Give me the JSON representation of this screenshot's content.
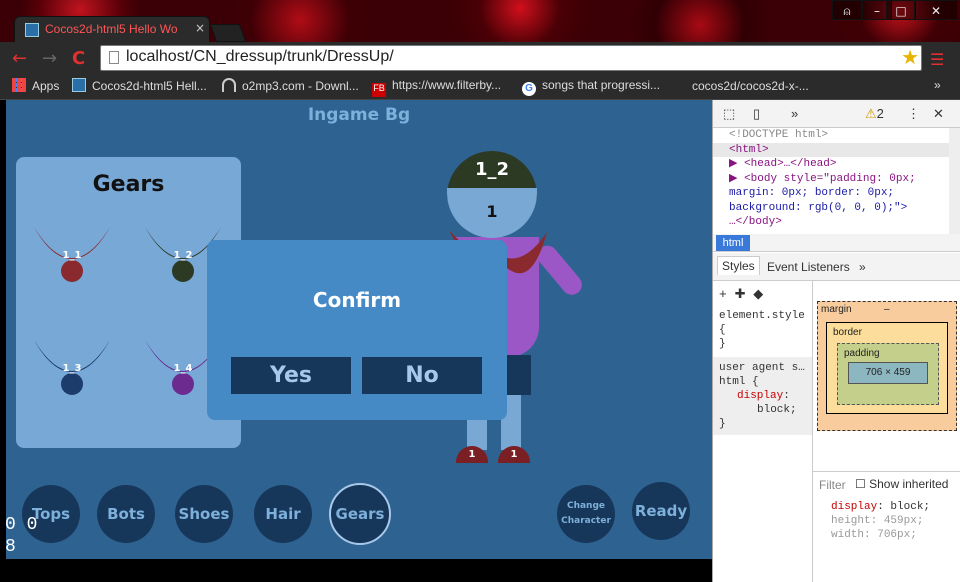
{
  "browser": {
    "tab_title": "Cocos2d-html5 Hello Wo",
    "tab_close": "×",
    "url": "localhost/CN_dressup/trunk/DressUp/",
    "window_minimize": "–",
    "window_maximize": "□",
    "window_close": "✕",
    "back": "←",
    "forward": "→",
    "reload": "C",
    "bookmarks": [
      {
        "label": "Apps"
      },
      {
        "label": "Cocos2d-html5 Hell..."
      },
      {
        "label": "o2mp3.com - Downl..."
      },
      {
        "label": "https://www.filterby..."
      },
      {
        "label": "songs that progressi..."
      },
      {
        "label": "cocos2d/cocos2d-x-..."
      }
    ],
    "bookmarks_more": "»"
  },
  "game": {
    "title": "Ingame Bg",
    "panel_title": "Gears",
    "gears": [
      {
        "label": "1_1",
        "color": "#8a2a2f"
      },
      {
        "label": "1_2",
        "color": "#2c3a24"
      },
      {
        "label": "1_3",
        "color": "#1c3c6c"
      },
      {
        "label": "1_4",
        "color": "#6b2b8f"
      }
    ],
    "character": {
      "head_top_label": "1_2",
      "head_bottom_label": "1",
      "shoe_left": "1",
      "shoe_right": "1"
    },
    "dialog": {
      "title": "Confirm",
      "yes": "Yes",
      "no": "No"
    },
    "categories": [
      {
        "label": "Tops"
      },
      {
        "label": "Bots"
      },
      {
        "label": "Shoes"
      },
      {
        "label": "Hair"
      },
      {
        "label": "Gears",
        "active": true
      }
    ],
    "change_character_line1": "Change",
    "change_character_line2": "Character",
    "ready": "Ready",
    "fps_line1": "0 0",
    "fps_line2": "8"
  },
  "devtools": {
    "warning_count": "2",
    "more": "»",
    "dom": {
      "doctype": "<!DOCTYPE html>",
      "html": "<html>",
      "head": "<head>…</head>",
      "body_open": "<body style=\"padding: 0px;",
      "body_l2": "margin: 0px; border: 0px;",
      "body_l3": "background: rgb(0, 0, 0);\">",
      "body_close": "…</body>"
    },
    "breadcrumb": "html",
    "tabs": [
      "Styles",
      "Event Listeners"
    ],
    "tabs_more": "»",
    "element_style": "element.style",
    "brace_open": "{",
    "brace_close": "}",
    "ua_label": "user agent s…",
    "ua_selector": "html {",
    "ua_prop": "display",
    "ua_value": "block;",
    "box": {
      "margin_label": "margin",
      "border_label": "border",
      "padding_label": "padding",
      "content": "706 × 459",
      "dash": "–"
    },
    "filter": "Filter",
    "show_inherited": "Show inherited",
    "computed": [
      {
        "prop": "display",
        "value": "block;"
      },
      {
        "prop": "height",
        "value": "459px;"
      },
      {
        "prop": "width",
        "value": "706px;"
      }
    ]
  }
}
